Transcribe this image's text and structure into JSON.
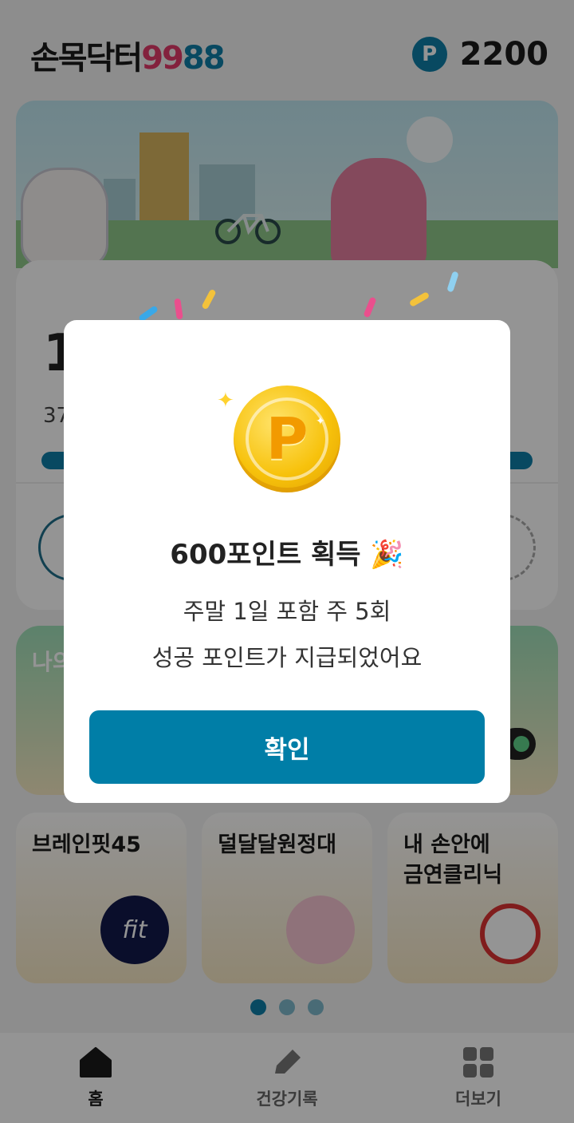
{
  "header": {
    "logo_text": "손목닥터",
    "logo_num1": "99",
    "logo_num2": "88",
    "points_badge": "P",
    "points_value": "2200"
  },
  "card": {
    "big_value": "1",
    "sub_value": "37"
  },
  "tile_green": {
    "label": "나의"
  },
  "tiles": [
    {
      "label": "브레인핏45",
      "icon": "brainfit-logo"
    },
    {
      "label": "덜달달원정대",
      "icon": "pink-mascot"
    },
    {
      "label": "내 손안에\n금연클리닉",
      "icon": "no-smoking-mascot"
    }
  ],
  "pager": {
    "count": 3,
    "active": 0
  },
  "bottom_nav": [
    {
      "label": "홈",
      "icon": "home-icon",
      "active": true
    },
    {
      "label": "건강기록",
      "icon": "pencil-icon",
      "active": false
    },
    {
      "label": "더보기",
      "icon": "grid-icon",
      "active": false
    }
  ],
  "modal": {
    "coin_letter": "P",
    "title": "600포인트 획득 🎉",
    "line1": "주말 1일 포함 주 5회",
    "line2": "성공 포인트가 지급되었어요",
    "confirm_label": "확인"
  },
  "colors": {
    "accent": "#007ea7",
    "logo_red": "#e23a6a",
    "logo_blue": "#0f7fa8",
    "coin": "#f7c20c"
  }
}
